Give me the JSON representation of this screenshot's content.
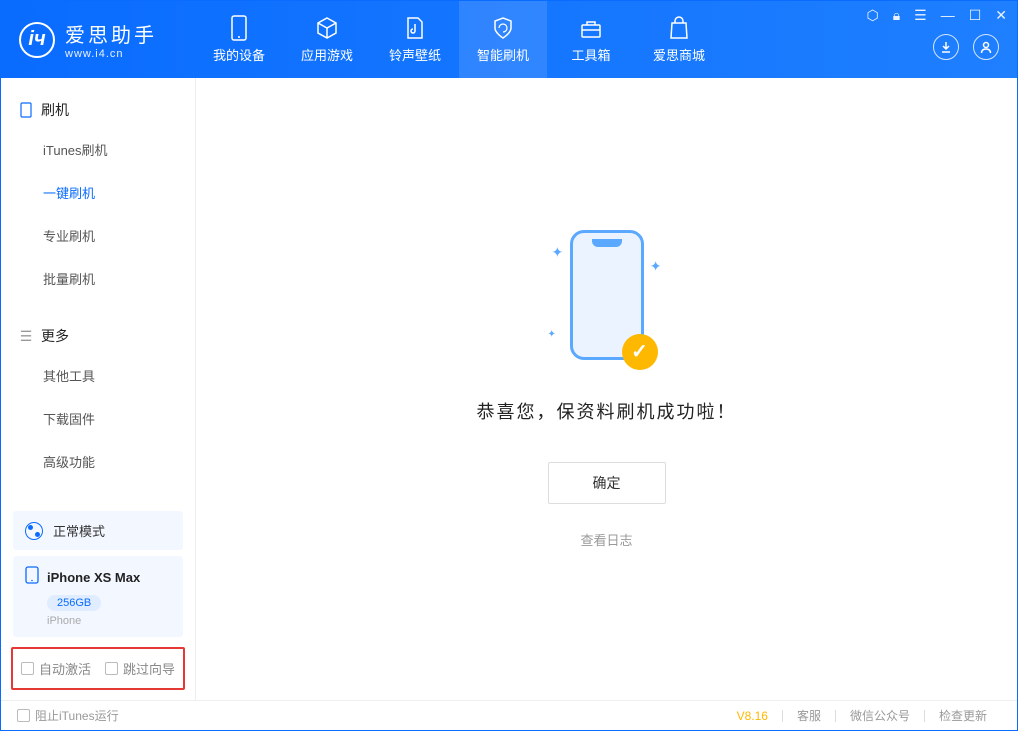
{
  "app": {
    "name": "爱思助手",
    "url": "www.i4.cn"
  },
  "tabs": [
    {
      "label": "我的设备"
    },
    {
      "label": "应用游戏"
    },
    {
      "label": "铃声壁纸"
    },
    {
      "label": "智能刷机"
    },
    {
      "label": "工具箱"
    },
    {
      "label": "爱思商城"
    }
  ],
  "sidebar": {
    "section1": {
      "title": "刷机",
      "items": [
        "iTunes刷机",
        "一键刷机",
        "专业刷机",
        "批量刷机"
      ]
    },
    "section2": {
      "title": "更多",
      "items": [
        "其他工具",
        "下载固件",
        "高级功能"
      ]
    },
    "mode": "正常模式",
    "device": {
      "name": "iPhone XS Max",
      "capacity": "256GB",
      "type": "iPhone"
    },
    "options": {
      "auto_activate": "自动激活",
      "skip_guide": "跳过向导"
    }
  },
  "main": {
    "success_message": "恭喜您，保资料刷机成功啦！",
    "confirm": "确定",
    "view_log": "查看日志"
  },
  "footer": {
    "block_itunes": "阻止iTunes运行",
    "version": "V8.16",
    "links": [
      "客服",
      "微信公众号",
      "检查更新"
    ]
  }
}
